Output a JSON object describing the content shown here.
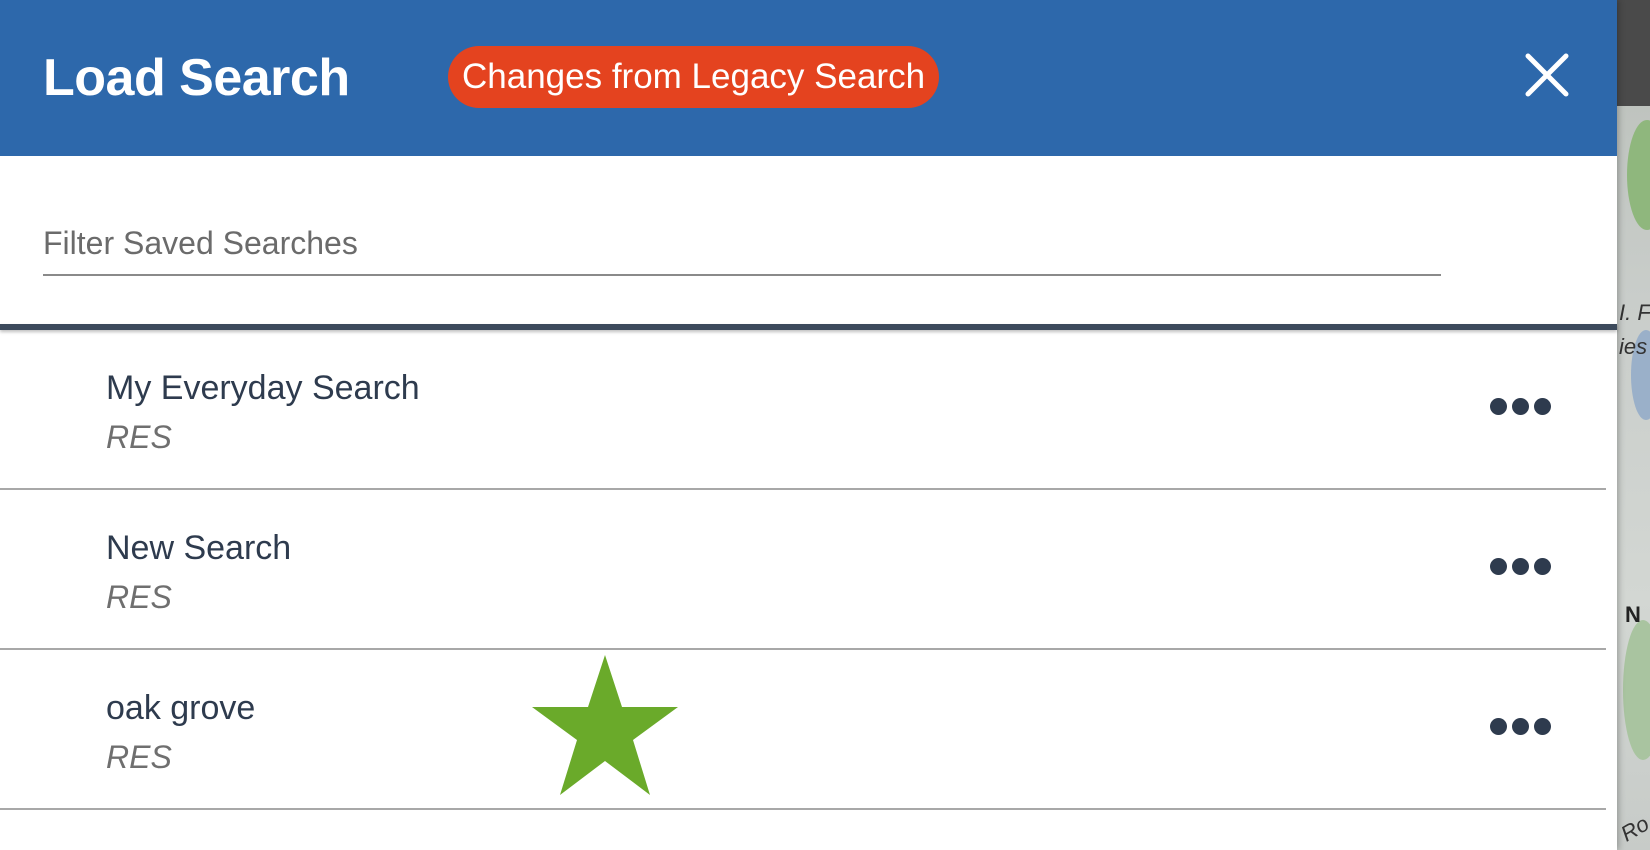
{
  "header": {
    "title": "Load Search",
    "legacy_badge": "Changes from Legacy Search",
    "close_icon": "close-icon"
  },
  "filter": {
    "placeholder": "Filter Saved Searches",
    "value": ""
  },
  "saved_searches": [
    {
      "name": "My Everyday Search",
      "type": "RES",
      "menu_icon": "more-horizontal-icon"
    },
    {
      "name": "New Search",
      "type": "RES",
      "menu_icon": "more-horizontal-icon"
    },
    {
      "name": "oak grove",
      "type": "RES",
      "menu_icon": "more-horizontal-icon"
    }
  ],
  "background_map": {
    "label_fragments": [
      "I. F",
      "ies",
      "N",
      "Ro"
    ]
  },
  "colors": {
    "header_bg": "#2d68ab",
    "badge_bg": "#e4431f",
    "star": "#6aaa2a",
    "text_dark": "#2e3b4e",
    "text_muted": "#6f6f6f"
  },
  "overlay": {
    "star_icon": "star-icon"
  }
}
